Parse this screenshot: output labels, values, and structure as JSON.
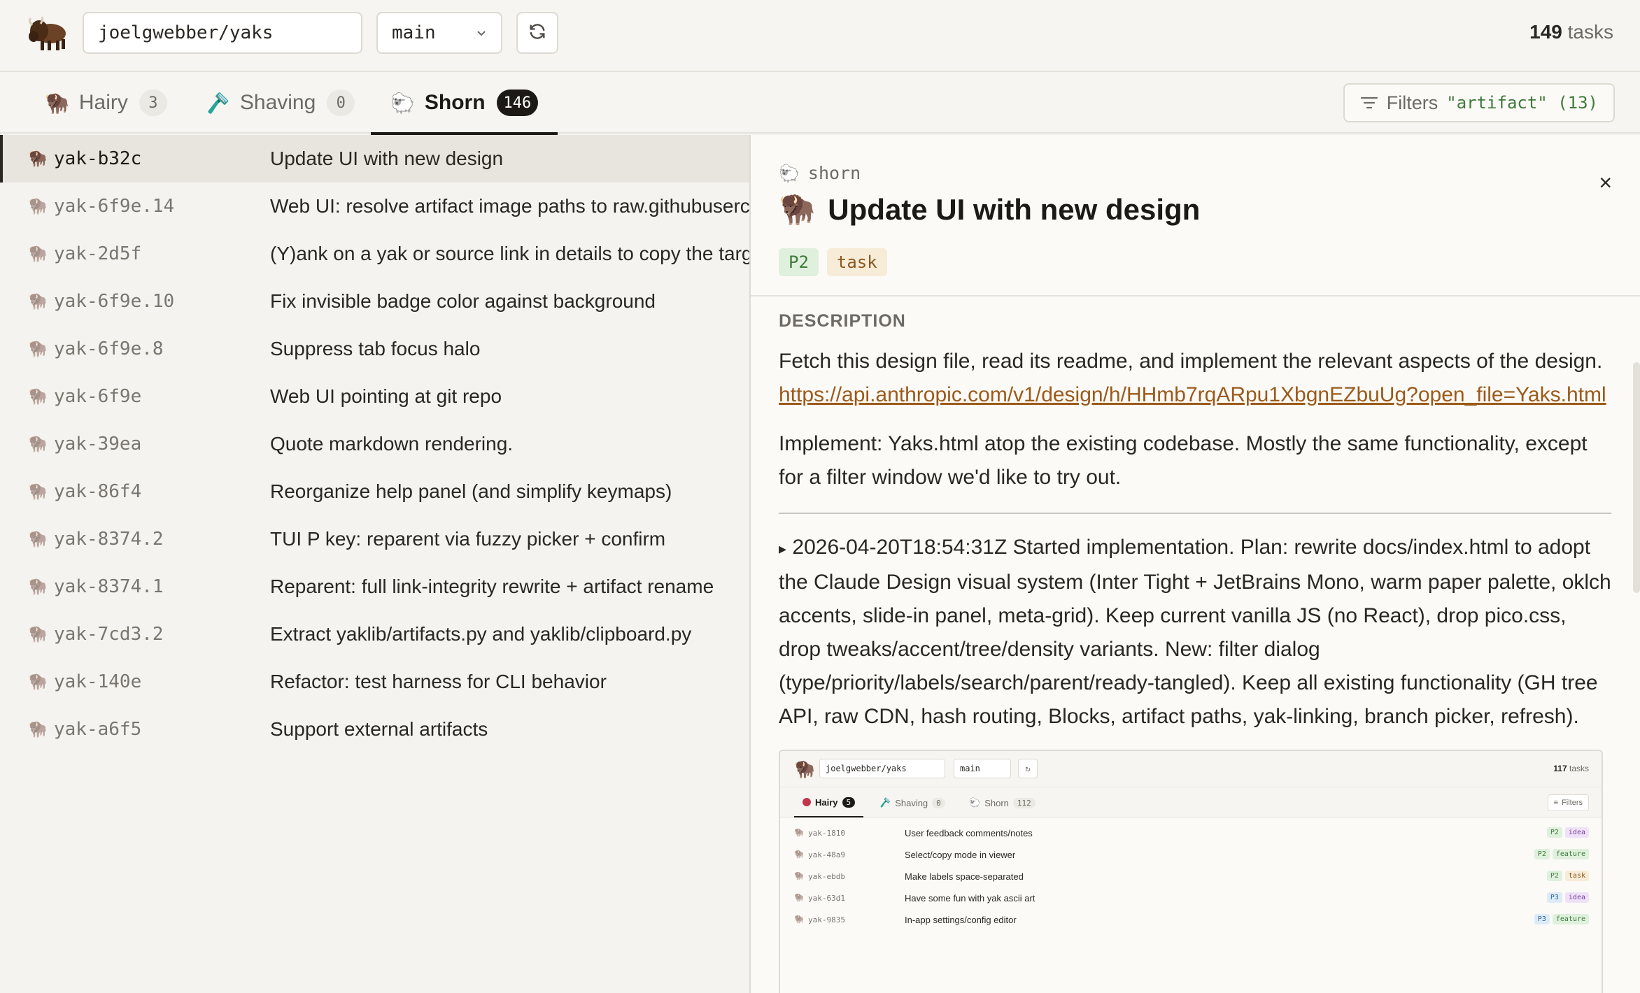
{
  "topbar": {
    "repo": "joelgwebber/yaks",
    "branch": "main",
    "task_count": "149",
    "task_count_label": "tasks"
  },
  "tabs": [
    {
      "label": "Hairy",
      "icon": "🦬",
      "count": "3"
    },
    {
      "label": "Shaving",
      "icon": "🪒",
      "count": "0"
    },
    {
      "label": "Shorn",
      "icon": "🐑",
      "count": "146"
    }
  ],
  "filters": {
    "label": "Filters",
    "value": "\"artifact\" (13)"
  },
  "list": [
    {
      "id": "yak-b32c",
      "title": "Update UI with new design"
    },
    {
      "id": "yak-6f9e.14",
      "title": "Web UI: resolve artifact image paths to raw.githubusercontent.com"
    },
    {
      "id": "yak-2d5f",
      "title": "(Y)ank on a yak or source link in details to copy the target"
    },
    {
      "id": "yak-6f9e.10",
      "title": "Fix invisible badge color against background"
    },
    {
      "id": "yak-6f9e.8",
      "title": "Suppress tab focus halo"
    },
    {
      "id": "yak-6f9e",
      "title": "Web UI pointing at git repo"
    },
    {
      "id": "yak-39ea",
      "title": "Quote markdown rendering."
    },
    {
      "id": "yak-86f4",
      "title": "Reorganize help panel (and simplify keymaps)"
    },
    {
      "id": "yak-8374.2",
      "title": "TUI P key: reparent via fuzzy picker + confirm"
    },
    {
      "id": "yak-8374.1",
      "title": "Reparent: full link-integrity rewrite + artifact rename"
    },
    {
      "id": "yak-7cd3.2",
      "title": "Extract yaklib/artifacts.py and yaklib/clipboard.py"
    },
    {
      "id": "yak-140e",
      "title": "Refactor: test harness for CLI behavior"
    },
    {
      "id": "yak-a6f5",
      "title": "Support external artifacts"
    }
  ],
  "detail": {
    "status": "shorn",
    "title": "Update UI with new design",
    "tags": [
      "P2",
      "task"
    ],
    "close": "×",
    "description_heading": "DESCRIPTION",
    "para1": "Fetch this design file, read its readme, and implement the relevant aspects of the design.",
    "link": "https://api.anthropic.com/v1/design/h/HHmb7rqARpu1XbgnEZbuUg?open_file=Yaks.html",
    "para2": "Implement: Yaks.html atop the existing codebase. Mostly the same functionality, except for a filter window we'd like to try out.",
    "log_marker": "▸",
    "log": "2026-04-20T18:54:31Z Started implementation. Plan: rewrite docs/index.html to adopt the Claude Design visual system (Inter Tight + JetBrains Mono, warm paper palette, oklch accents, slide-in panel, meta-grid). Keep current vanilla JS (no React), drop pico.css, drop tweaks/accent/tree/density variants. New: filter dialog (type/priority/labels/search/parent/ready-tangled). Keep all existing functionality (GH tree API, raw CDN, hash routing, Blocks, artifact paths, yak-linking, branch picker, refresh)."
  },
  "screenshot": {
    "repo": "joelgwebber/yaks",
    "branch": "main",
    "task_count": "117",
    "task_count_label": "tasks",
    "tabs": [
      {
        "label": "Hairy",
        "count": "5"
      },
      {
        "label": "Shaving",
        "count": "0"
      },
      {
        "label": "Shorn",
        "count": "112"
      }
    ],
    "filters": "Filters",
    "rows": [
      {
        "id": "yak-1810",
        "title": "User feedback comments/notes",
        "priority": "P2",
        "type": "idea"
      },
      {
        "id": "yak-48a9",
        "title": "Select/copy mode in viewer",
        "priority": "P2",
        "type": "feature"
      },
      {
        "id": "yak-ebdb",
        "title": "Make labels space-separated",
        "priority": "P2",
        "type": "task"
      },
      {
        "id": "yak-63d1",
        "title": "Have some fun with yak ascii art",
        "priority": "P3",
        "type": "idea"
      },
      {
        "id": "yak-9835",
        "title": "In-app settings/config editor",
        "priority": "P3",
        "type": "feature"
      }
    ]
  },
  "icons": {
    "logo": "bison-logo-icon",
    "yak": "bison-icon",
    "shorn": "sheep-icon",
    "shaving": "razor-icon",
    "refresh": "refresh-icon",
    "chevron": "chevron-down-icon",
    "filter": "filter-icon",
    "close": "close-icon"
  }
}
